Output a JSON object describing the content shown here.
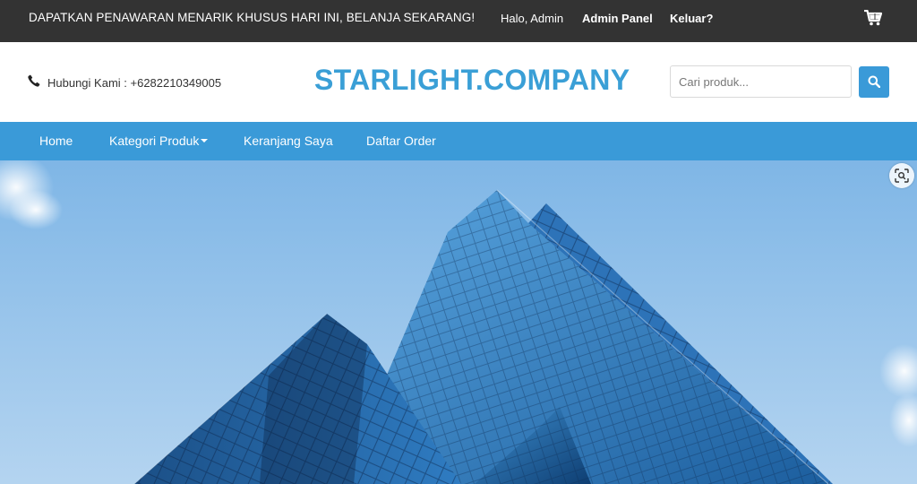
{
  "topbar": {
    "promo_text": "DAPATKAN PENAWARAN MENARIK KHUSUS HARI INI, BELANJA SEKARANG!",
    "greeting": "Halo, Admin",
    "admin_panel_label": "Admin Panel",
    "logout_label": "Keluar?",
    "cart_icon": "shopping-cart-icon"
  },
  "header": {
    "contact_text": "Hubungi Kami : +6282210349005",
    "phone_icon": "phone-icon",
    "logo": "STARLIGHT.COMPANY",
    "search_placeholder": "Cari produk...",
    "search_icon": "search-icon"
  },
  "nav": {
    "items": [
      {
        "label": "Home"
      },
      {
        "label": "Kategori Produk",
        "dropdown": true
      },
      {
        "label": "Keranjang Saya"
      },
      {
        "label": "Daftar Order"
      }
    ]
  },
  "hero": {
    "image": "glass-skyscraper-photo",
    "zoom_icon": "visual-search-icon"
  },
  "colors": {
    "topbar_bg": "#333333",
    "brand": "#3a9fd6",
    "nav_bg": "#3a9ad8",
    "sky": "#8ec1ea"
  }
}
